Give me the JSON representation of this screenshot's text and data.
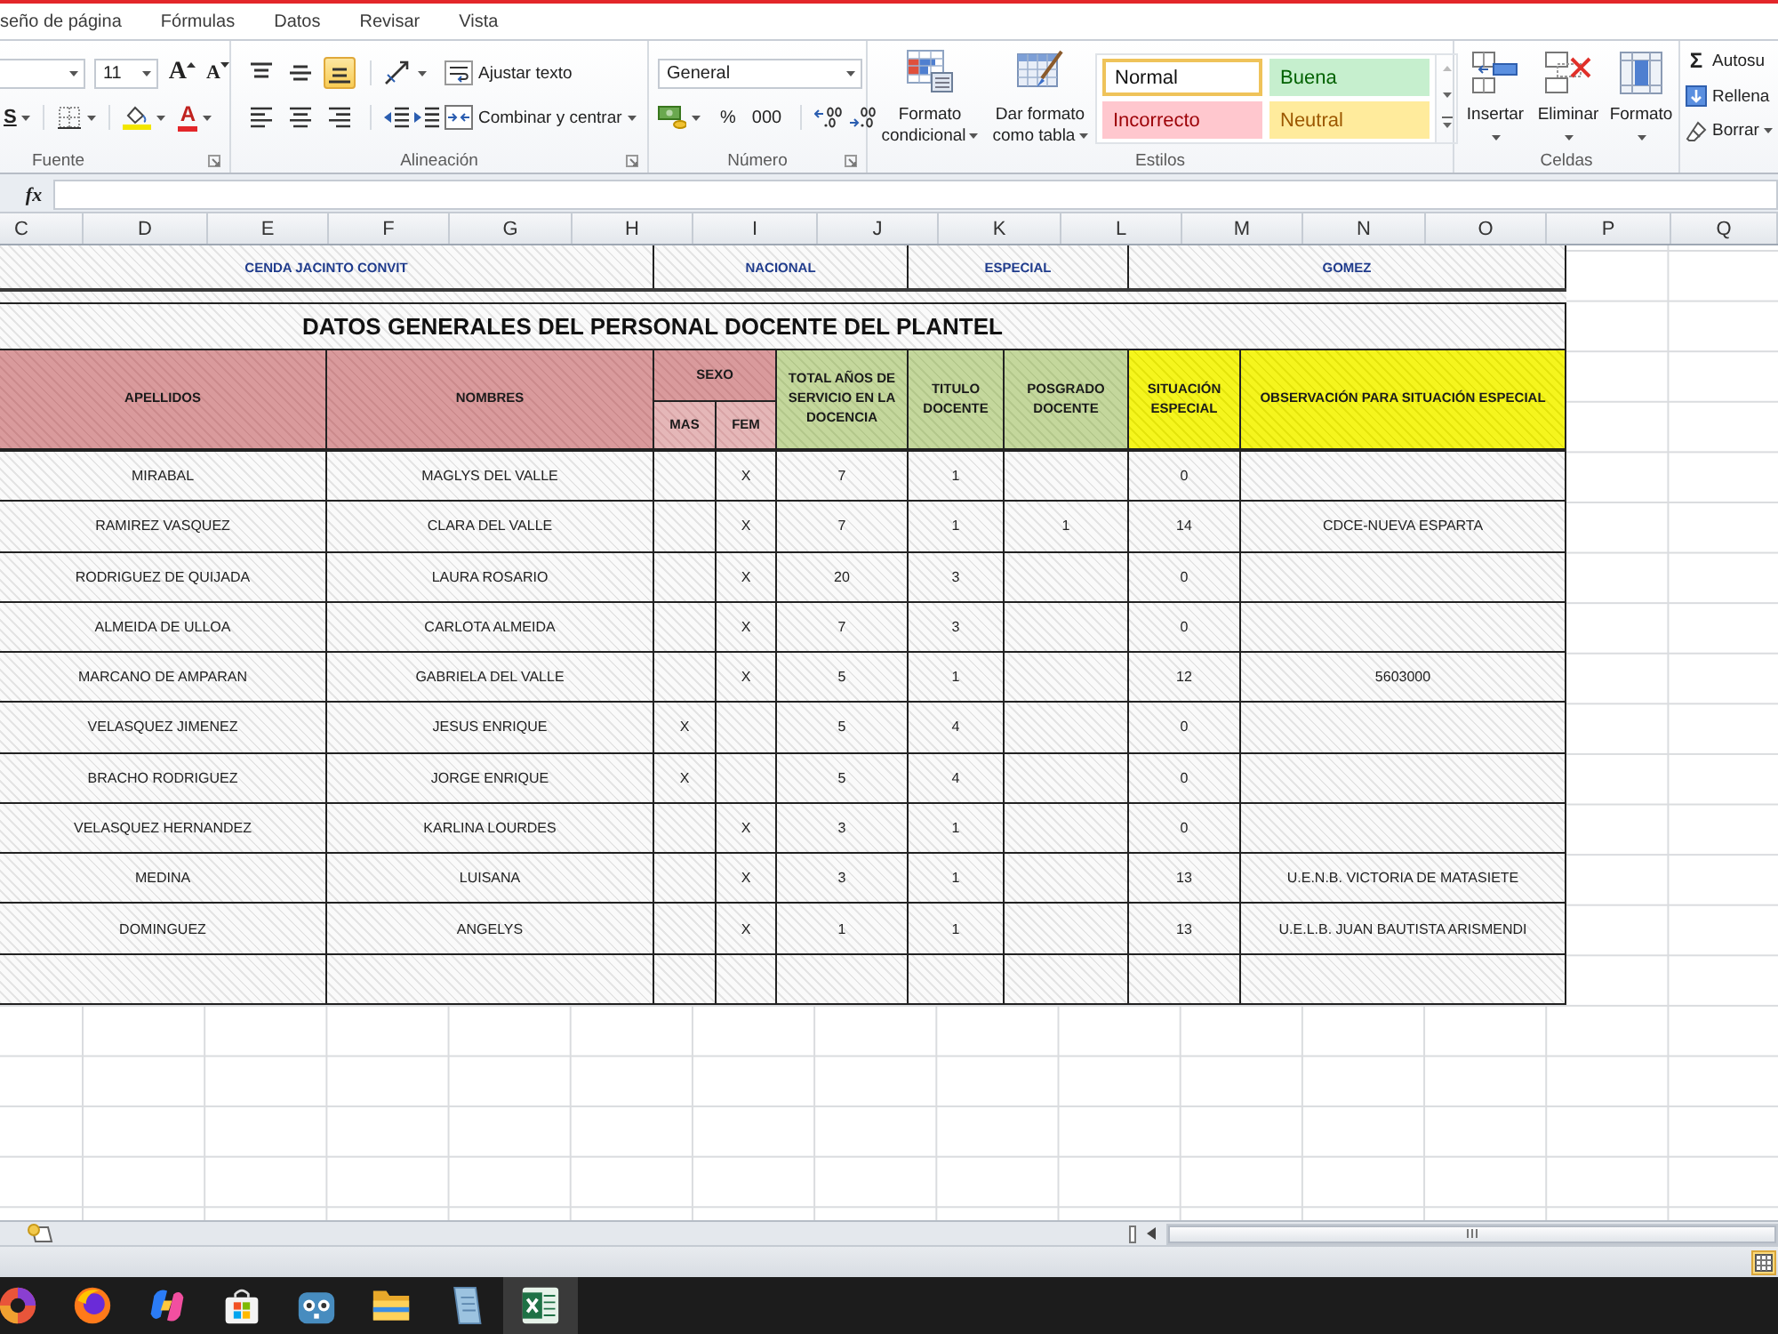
{
  "ribbon_tabs": [
    {
      "label": "seño de página",
      "selected": false
    },
    {
      "label": "Fórmulas",
      "selected": false
    },
    {
      "label": "Datos",
      "selected": false
    },
    {
      "label": "Revisar",
      "selected": false
    },
    {
      "label": "Vista",
      "selected": false
    }
  ],
  "font_group": {
    "label": "Fuente",
    "font_size": "11",
    "grow_font": "A",
    "shrink_font": "A",
    "underline": "S",
    "font_color": "A"
  },
  "alignment_group": {
    "label": "Alineación",
    "vertical": [
      {
        "kind": "top",
        "selected": false
      },
      {
        "kind": "middle",
        "selected": false
      },
      {
        "kind": "bottom",
        "selected": true
      }
    ],
    "horizontal": [
      {
        "kind": "left",
        "selected": false
      },
      {
        "kind": "center",
        "selected": false
      },
      {
        "kind": "right",
        "selected": false
      }
    ],
    "wrap_text": "Ajustar texto",
    "merge_center": "Combinar y centrar"
  },
  "number_group": {
    "label": "Número",
    "format": "General",
    "percent": "%",
    "thousands": "000"
  },
  "styles_group": {
    "label": "Estilos",
    "conditional_format": "Formato condicional",
    "format_as_table": "Dar formato como tabla",
    "cell_styles": [
      {
        "label": "Normal",
        "kind": "normal",
        "selected": true
      },
      {
        "label": "Buena",
        "kind": "good",
        "selected": false
      },
      {
        "label": "Incorrecto",
        "kind": "bad",
        "selected": false
      },
      {
        "label": "Neutral",
        "kind": "neutral",
        "selected": false
      }
    ]
  },
  "cells_group": {
    "label": "Celdas",
    "buttons": [
      {
        "label": "Insertar",
        "kind": "insert"
      },
      {
        "label": "Eliminar",
        "kind": "delete"
      },
      {
        "label": "Formato",
        "kind": "format"
      }
    ]
  },
  "editing_group": {
    "items": [
      {
        "kind": "sum",
        "symbol": "Σ",
        "label": "Autosu"
      },
      {
        "kind": "fill",
        "label": "Rellena"
      },
      {
        "kind": "clear",
        "label": "Borrar"
      }
    ]
  },
  "formula_bar": {
    "function_label": "fx"
  },
  "columns": [
    "C",
    "D",
    "E",
    "F",
    "G",
    "H",
    "I",
    "J",
    "K",
    "L",
    "M",
    "N",
    "O",
    "P",
    "Q"
  ],
  "table": {
    "banner": [
      "CENDA JACINTO CONVIT",
      "NACIONAL",
      "ESPECIAL",
      "GOMEZ"
    ],
    "title": "DATOS GENERALES DEL PERSONAL DOCENTE DEL PLANTEL",
    "headers": {
      "apellidos": "APELLIDOS",
      "nombres": "NOMBRES",
      "sexo": "SEXO",
      "mas": "MAS",
      "fem": "FEM",
      "anos": "TOTAL AÑOS DE SERVICIO EN LA DOCENCIA",
      "titulo": "TITULO DOCENTE",
      "posgrado": "POSGRADO DOCENTE",
      "situacion": "SITUACIÓN ESPECIAL",
      "observacion": "OBSERVACIÓN PARA SITUACIÓN ESPECIAL"
    },
    "rows": [
      {
        "apellidos": "MIRABAL",
        "nombres": "MAGLYS DEL VALLE",
        "fem": "X",
        "anos": "7",
        "titulo": "1",
        "situacion": "0"
      },
      {
        "apellidos": "RAMIREZ VASQUEZ",
        "nombres": "CLARA DEL VALLE",
        "fem": "X",
        "anos": "7",
        "titulo": "1",
        "posgrado": "1",
        "situacion": "14",
        "observacion": "CDCE-NUEVA ESPARTA"
      },
      {
        "apellidos": "RODRIGUEZ DE QUIJADA",
        "nombres": "LAURA ROSARIO",
        "fem": "X",
        "anos": "20",
        "titulo": "3",
        "situacion": "0"
      },
      {
        "apellidos": "ALMEIDA DE ULLOA",
        "nombres": "CARLOTA ALMEIDA",
        "fem": "X",
        "anos": "7",
        "titulo": "3",
        "situacion": "0"
      },
      {
        "apellidos": "MARCANO DE AMPARAN",
        "nombres": "GABRIELA DEL VALLE",
        "fem": "X",
        "anos": "5",
        "titulo": "1",
        "situacion": "12",
        "observacion": "5603000"
      },
      {
        "apellidos": "VELASQUEZ JIMENEZ",
        "nombres": "JESUS ENRIQUE",
        "mas": "X",
        "anos": "5",
        "titulo": "4",
        "situacion": "0"
      },
      {
        "apellidos": "BRACHO RODRIGUEZ",
        "nombres": "JORGE ENRIQUE",
        "mas": "X",
        "anos": "5",
        "titulo": "4",
        "situacion": "0"
      },
      {
        "apellidos": "VELASQUEZ HERNANDEZ",
        "nombres": "KARLINA LOURDES",
        "fem": "X",
        "anos": "3",
        "titulo": "1",
        "situacion": "0"
      },
      {
        "apellidos": "MEDINA",
        "nombres": "LUISANA",
        "fem": "X",
        "anos": "3",
        "titulo": "1",
        "situacion": "13",
        "observacion": "U.E.N.B. VICTORIA DE MATASIETE"
      },
      {
        "apellidos": "DOMINGUEZ",
        "nombres": "ANGELYS",
        "fem": "X",
        "anos": "1",
        "titulo": "1",
        "situacion": "13",
        "observacion": "U.E.L.B. JUAN BAUTISTA ARISMENDI"
      }
    ]
  },
  "status_bar": {
    "views": [
      {
        "kind": "normal",
        "selected": true
      }
    ]
  },
  "taskbar": {
    "apps": [
      {
        "kind": "swirl",
        "selected": false
      },
      {
        "kind": "globe",
        "selected": false
      },
      {
        "kind": "ribbon",
        "selected": false
      },
      {
        "kind": "bag",
        "selected": false
      },
      {
        "kind": "robot",
        "selected": false
      },
      {
        "kind": "folder",
        "selected": false
      },
      {
        "kind": "page",
        "selected": false
      },
      {
        "kind": "sheet",
        "selected": true
      }
    ]
  }
}
